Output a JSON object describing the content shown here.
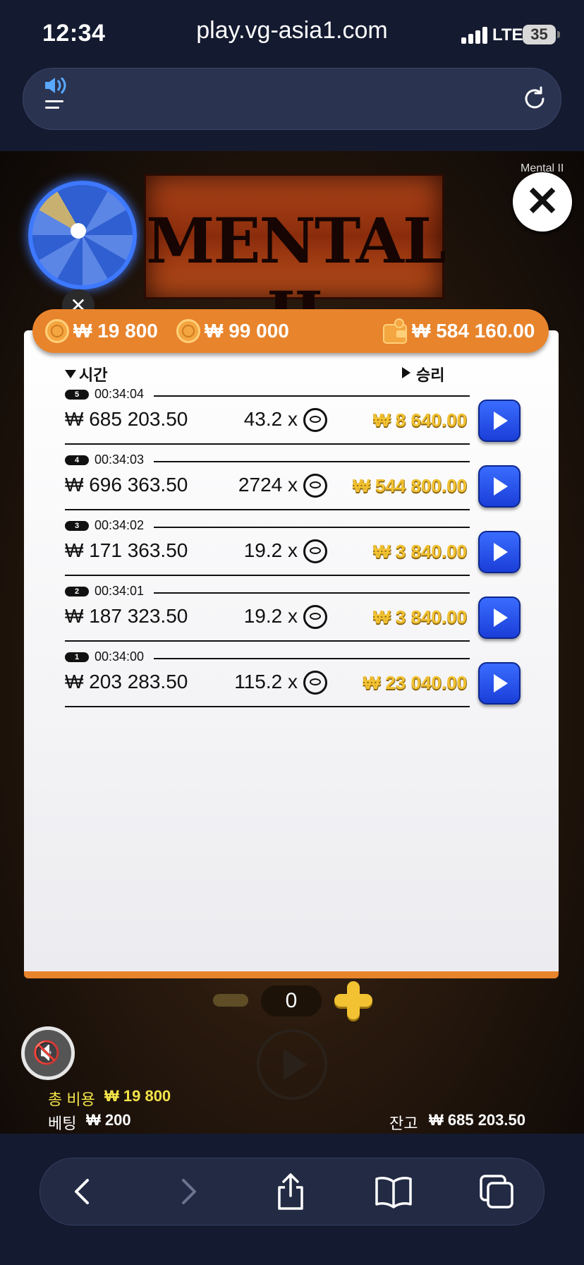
{
  "status_bar": {
    "time": "12:34",
    "network": "LTE",
    "battery": "35"
  },
  "browser": {
    "url": "play.vg-asia1.com"
  },
  "game": {
    "name": "Mental II",
    "logo_text": "MENTAL II",
    "top_bar": {
      "coin_value_1": "₩ 19 800",
      "coin_value_2": "₩ 99 000",
      "balance": "₩ 584 160.00"
    },
    "history": {
      "col_time": "시간",
      "col_win": "승리",
      "rows": [
        {
          "index": "5",
          "time": "00:34:04",
          "amount": "₩ 685 203.50",
          "multiplier": "43.2 x",
          "win": "₩ 8 640.00"
        },
        {
          "index": "4",
          "time": "00:34:03",
          "amount": "₩ 696 363.50",
          "multiplier": "2724 x",
          "win": "₩ 544 800.00"
        },
        {
          "index": "3",
          "time": "00:34:02",
          "amount": "₩ 171 363.50",
          "multiplier": "19.2 x",
          "win": "₩ 3 840.00"
        },
        {
          "index": "2",
          "time": "00:34:01",
          "amount": "₩ 187 323.50",
          "multiplier": "19.2 x",
          "win": "₩ 3 840.00"
        },
        {
          "index": "1",
          "time": "00:34:00",
          "amount": "₩ 203 283.50",
          "multiplier": "115.2 x",
          "win": "₩ 23 040.00"
        }
      ]
    },
    "controls": {
      "bet_count": "0"
    },
    "footer": {
      "total_cost_label": "총 비용",
      "total_cost_value": "₩ 19 800",
      "bet_label": "베팅",
      "bet_value": "₩ 200",
      "balance_label": "잔고",
      "balance_value": "₩ 685 203.50"
    }
  },
  "colors": {
    "accent_orange": "#e8842c",
    "win_gold": "#f2c232",
    "play_blue": "#1a3ed8"
  },
  "icons": [
    "speaker-icon",
    "reload-icon",
    "close-icon",
    "coin-icon",
    "wallet-icon",
    "play-icon",
    "mute-icon",
    "back-icon",
    "forward-icon",
    "share-icon",
    "bookmarks-icon",
    "tabs-icon"
  ]
}
